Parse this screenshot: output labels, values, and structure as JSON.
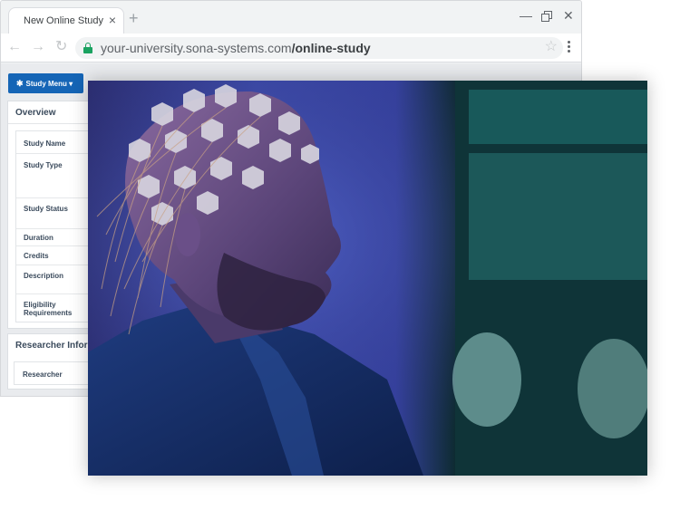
{
  "browser": {
    "tab_title": "New Online Study",
    "tab_close": "×",
    "new_tab": "+",
    "win_minimize": "—",
    "win_close": "✕",
    "nav_back": "←",
    "nav_forward": "→",
    "nav_reload": "↻",
    "url_host": "your-university.sona-systems.com",
    "url_path": "/online-study",
    "bookmark": "☆"
  },
  "toolbar": {
    "study_menu_label": "Study Menu",
    "gear_glyph": "✱",
    "caret_glyph": "▾"
  },
  "overview": {
    "title": "Overview",
    "fields": [
      {
        "label": "Study Name"
      },
      {
        "label": "Study Type"
      },
      {
        "label": "Study Status"
      },
      {
        "label": "Duration"
      },
      {
        "label": "Credits"
      },
      {
        "label": "Description"
      },
      {
        "label": "Eligibility Requirements"
      }
    ]
  },
  "researcher": {
    "title": "Researcher Information",
    "field_label": "Researcher"
  },
  "colors": {
    "accent": "#1565b6",
    "secure_green": "#1aa260",
    "panel_text": "#3a4a5c"
  }
}
